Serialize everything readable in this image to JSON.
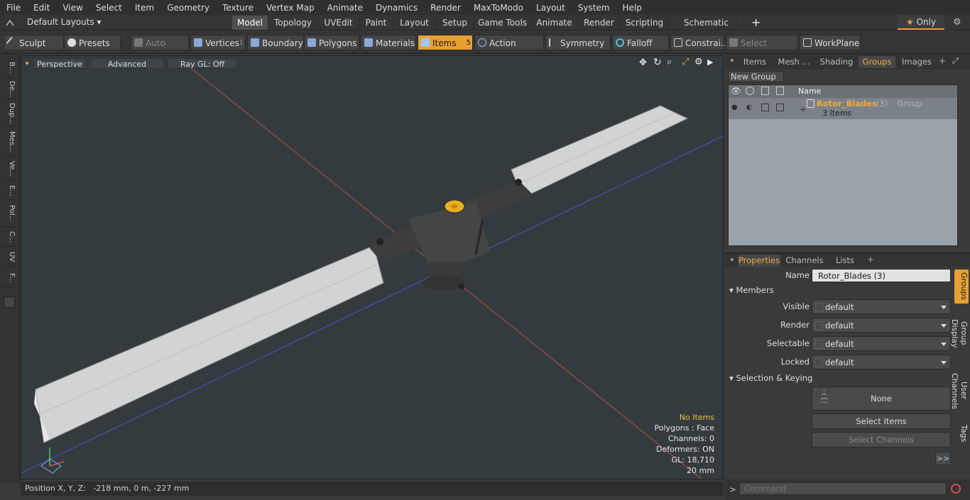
{
  "menu": {
    "items": [
      "File",
      "Edit",
      "View",
      "Select",
      "Item",
      "Geometry",
      "Texture",
      "Vertex Map",
      "Animate",
      "Dynamics",
      "Render",
      "MaxToModo",
      "Layout",
      "System",
      "Help"
    ],
    "layouts": "Default Layouts"
  },
  "tabs": [
    "Model",
    "Topology",
    "UVEdit",
    "Paint",
    "Layout",
    "Setup",
    "Game Tools",
    "Animate",
    "Render",
    "Scripting",
    "Schematic Fusion"
  ],
  "only": "Only",
  "toolbar": {
    "sculpt": "Sculpt",
    "presets": "Presets",
    "auto_select": "Auto Select",
    "vertices": "Vertices",
    "vertices_count": "1",
    "boundary": "Boundary",
    "polygons": "Polygons",
    "materials": "Materials",
    "items": "Items",
    "items_count": "5",
    "action_center": "Action Center",
    "symmetry": "Symmetry",
    "falloff": "Falloff",
    "constraints": "Constrai...",
    "select_through": "Select Through",
    "workplane": "WorkPlane"
  },
  "sidebar_tabs": [
    "B...",
    "De...",
    "Dup...",
    "Mes...",
    "Ve...",
    "E...",
    "Pol...",
    "C...",
    "UV",
    "F..."
  ],
  "viewport": {
    "perspective": "Perspective",
    "advanced": "Advanced",
    "raygl": "Ray GL: Off",
    "info": {
      "items": "No Items",
      "polygons": "Polygons : Face",
      "channels": "Channels: 0",
      "deformers": "Deformers: ON",
      "gl": "GL: 18,710",
      "scale": "20 mm"
    }
  },
  "status": {
    "label": "Position X, Y, Z:",
    "value": "-218 mm, 0 m, -227 mm"
  },
  "panel_tabs": [
    "Items",
    "Mesh ...",
    "Shading",
    "Groups",
    "Images"
  ],
  "groups": {
    "new_group": "New Group",
    "name_col": "Name",
    "item_name": "Rotor_Blades",
    "item_count": "(3)",
    "item_type": ": Group",
    "item_sub": "3 Items"
  },
  "props": {
    "tabs": [
      "Properties",
      "Channels",
      "Lists"
    ],
    "name_label": "Name",
    "name_value": "Rotor_Blades (3)",
    "members": "Members",
    "visible": "Visible",
    "render": "Render",
    "selectable": "Selectable",
    "locked": "Locked",
    "default": "default",
    "sel_keying": "Selection & Keying",
    "none": "None",
    "select_items": "Select Items",
    "select_channels": "Select Channels",
    "more": ">>",
    "side_tabs": [
      "Groups",
      "Group Display",
      "User Channels",
      "Tags"
    ]
  },
  "command": {
    "placeholder": "Command"
  },
  "colors": {
    "accent": "#e8a033",
    "viewport": "#343b3f"
  }
}
